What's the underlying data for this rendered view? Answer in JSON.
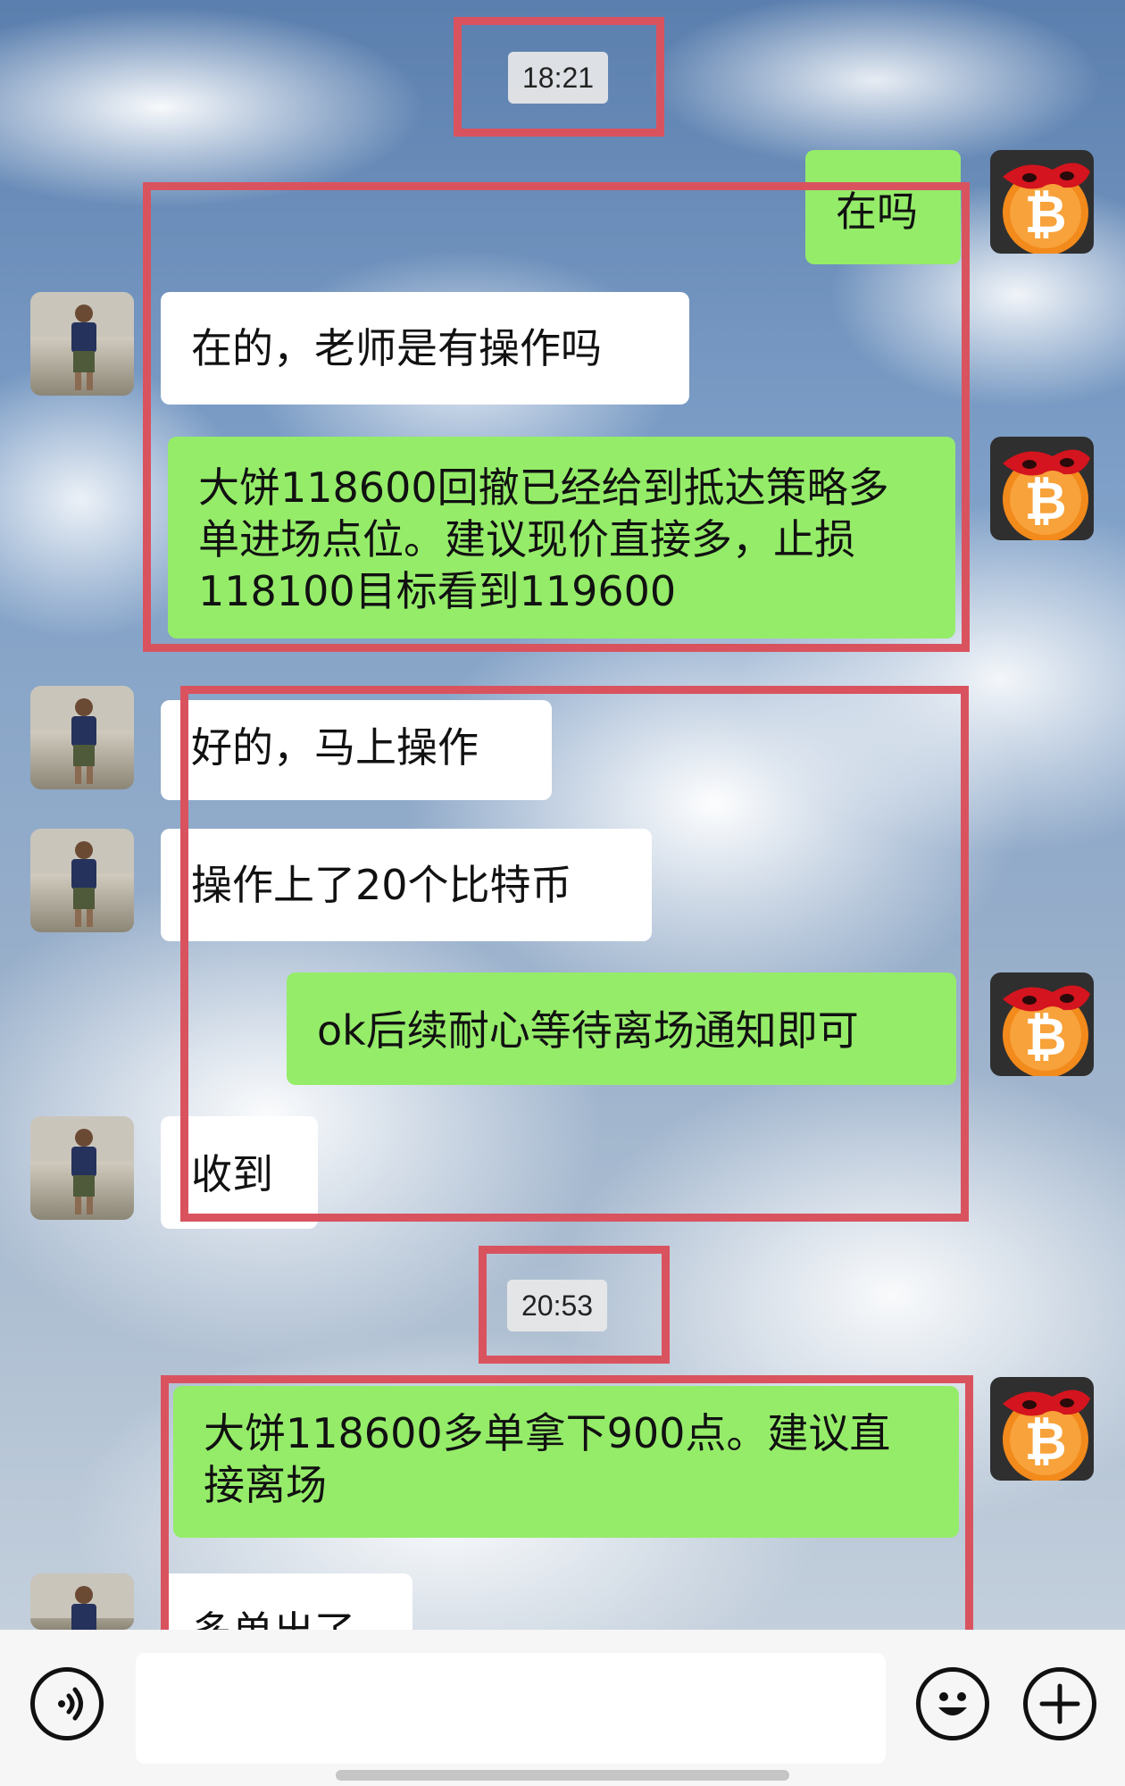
{
  "chat": {
    "time1": "18:21",
    "time2": "20:53",
    "messages": [
      {
        "side": "out",
        "text": "在吗"
      },
      {
        "side": "in",
        "text": "在的，老师是有操作吗"
      },
      {
        "side": "out",
        "text": "大饼118600回撤已经给到抵达策略多单进场点位。建议现价直接多，止损118100目标看到119600"
      },
      {
        "side": "in",
        "text": "好的，马上操作"
      },
      {
        "side": "in",
        "text": "操作上了20个比特币"
      },
      {
        "side": "out",
        "text": "ok后续耐心等待离场通知即可"
      },
      {
        "side": "in",
        "text": "收到"
      },
      {
        "side": "out",
        "text": "大饼118600多单拿下900点。建议直接离场"
      },
      {
        "side": "in",
        "text": "多单出了"
      }
    ]
  },
  "colors": {
    "out_bubble": "#95ec69",
    "in_bubble": "#ffffff",
    "highlight_box": "#d9535f"
  },
  "icons": {
    "voice": "voice-icon",
    "emoji": "emoji-icon",
    "plus": "plus-icon",
    "bitcoin_avatar": "bitcoin-mask-avatar",
    "user_avatar": "user-photo-avatar"
  }
}
